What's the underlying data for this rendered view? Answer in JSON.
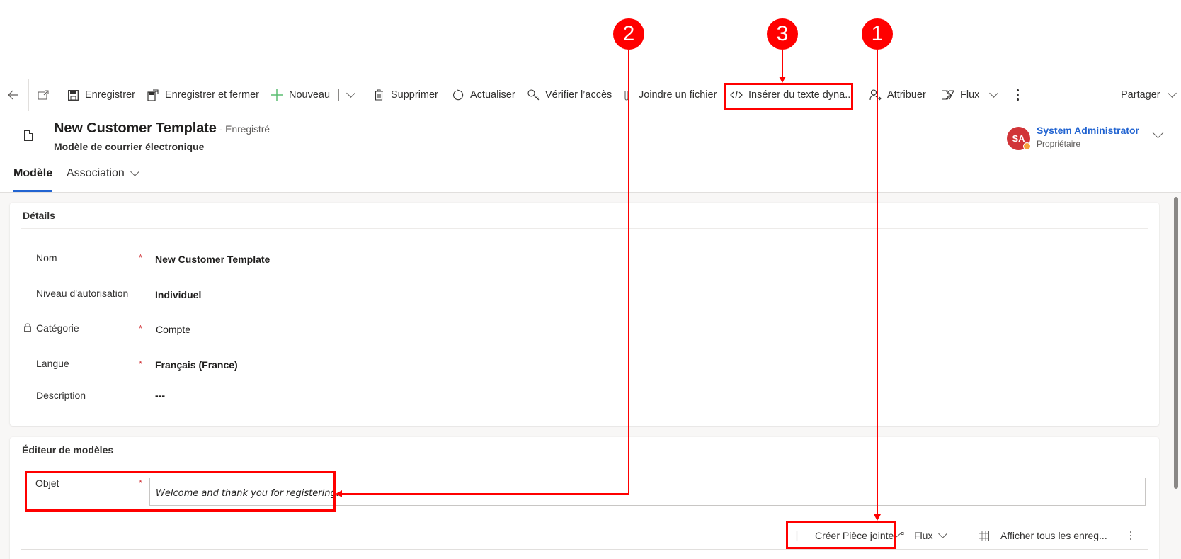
{
  "command_bar": {
    "back_icon": "arrow-left-icon",
    "popout_icon": "open-in-new-window-icon",
    "items": [
      {
        "label": "Enregistrer",
        "icon": "save-icon"
      },
      {
        "label": "Enregistrer et fermer",
        "icon": "save-and-close-icon"
      },
      {
        "label": "Nouveau",
        "icon": "plus-icon"
      },
      {
        "label": "Supprimer",
        "icon": "trash-icon"
      },
      {
        "label": "Actualiser",
        "icon": "refresh-icon"
      },
      {
        "label": "Vérifier l’accès",
        "icon": "key-icon"
      },
      {
        "label": "Joindre un fichier",
        "icon": "paperclip-icon"
      },
      {
        "label": "Insérer du texte dyna...",
        "icon": "code-icon"
      },
      {
        "label": "Attribuer",
        "icon": "assign-person-icon"
      },
      {
        "label": "Flux",
        "icon": "flow-icon"
      }
    ],
    "share_label": "Partager"
  },
  "header": {
    "title": "New Customer Template",
    "status": "- Enregistré",
    "entity": "Modèle de courrier électronique",
    "owner": {
      "initials": "SA",
      "name": "System Administrator",
      "role": "Propriétaire",
      "avatar_color": "#d13438",
      "presence_color": "#f7a23b"
    }
  },
  "tabs": [
    {
      "label": "Modèle",
      "active": true
    },
    {
      "label": "Association",
      "active": false
    }
  ],
  "details": {
    "title": "Détails",
    "fields": [
      {
        "label": "Nom",
        "required": true,
        "value": "New Customer Template"
      },
      {
        "label": "Niveau d'autorisation",
        "required": false,
        "value": "Individuel"
      },
      {
        "label": "Catégorie",
        "required": true,
        "value": "Compte",
        "locked": true
      },
      {
        "label": "Langue",
        "required": true,
        "value": "Français (France)"
      },
      {
        "label": "Description",
        "required": false,
        "value": "---"
      }
    ]
  },
  "editor": {
    "title": "Éditeur de modèles",
    "subject_label": "Objet",
    "subject_value": "Welcome and thank you for registering.",
    "subgrid_commands": [
      {
        "label": "Créer Pièce jointe",
        "icon": "plus-icon"
      },
      {
        "label": "Flux",
        "icon": "flow-icon"
      },
      {
        "label": "Afficher tous les enreg...",
        "icon": "grid-view-icon"
      }
    ]
  },
  "annotations": [
    {
      "number": "1"
    },
    {
      "number": "2"
    },
    {
      "number": "3"
    }
  ],
  "colors": {
    "accent": "#2264d1",
    "annotation": "#ff0000",
    "required": "#d13438"
  }
}
